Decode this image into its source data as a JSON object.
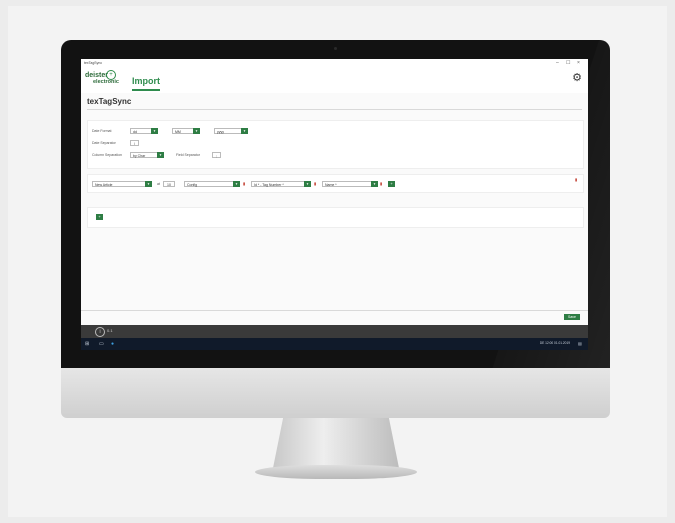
{
  "window": {
    "title": "texTagSync",
    "controls": [
      "–",
      "☐",
      "×"
    ]
  },
  "header": {
    "logo_line1": "deister",
    "logo_line2": "electronic",
    "tab_import": "Import"
  },
  "page_title": "texTagSync",
  "format_panel": {
    "date_format_label": "Date Format",
    "date_format_day": "dd",
    "date_format_month": "MM",
    "date_format_year": "yyyy",
    "date_separator_label": "Date Separator",
    "date_separator_value": "/",
    "column_separation_label": "Column Separation",
    "column_separation_value": "by Char",
    "field_separator_label": "Field Separator",
    "field_separator_value": ";"
  },
  "mapping_row": {
    "field_select": "New Article",
    "at_label": "at",
    "position_value": "10",
    "type_select": "Config",
    "tag_select": "Id * - Tag Number *",
    "name_select": "Name *"
  },
  "footer": {
    "save_label": "Save",
    "version": "0.1"
  },
  "taskbar": {
    "tray_text": "DE 12:00",
    "tray_date": "01.01.2019"
  },
  "colors": {
    "accent": "#2e7d44",
    "delete": "#c0392b"
  },
  "icons": [
    "settings-gear-icon",
    "trash-icon",
    "plus-icon",
    "info-icon",
    "windows-start-icon"
  ]
}
